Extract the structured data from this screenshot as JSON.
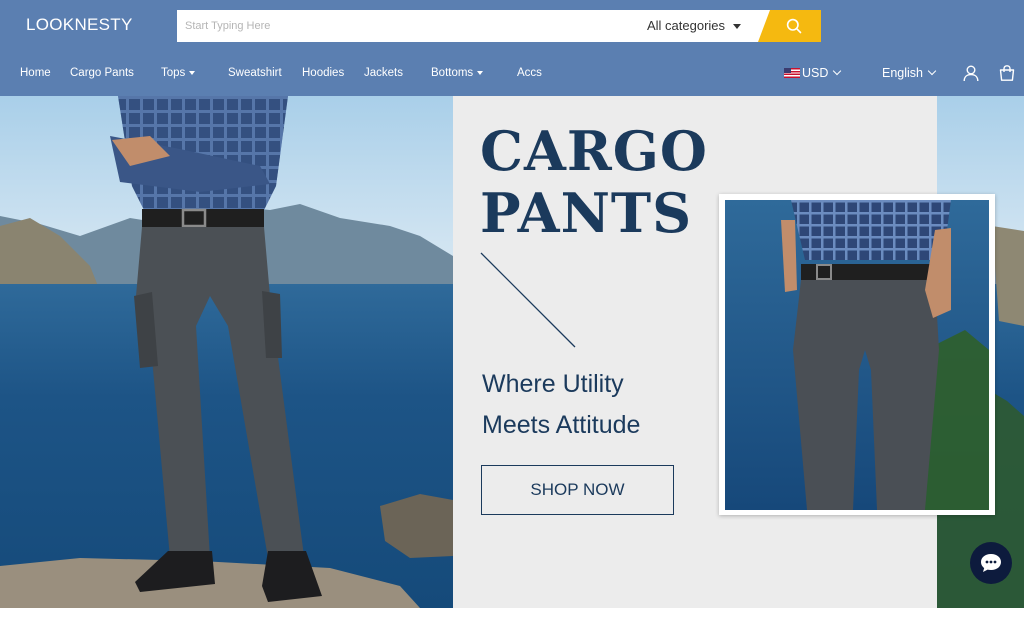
{
  "brand": {
    "name": "LOOKNESTY"
  },
  "search": {
    "placeholder": "Start Typing Here",
    "category": "All categories"
  },
  "nav": {
    "items": [
      {
        "label": "Home",
        "has_dropdown": false
      },
      {
        "label": "Cargo Pants",
        "has_dropdown": false
      },
      {
        "label": "Tops",
        "has_dropdown": true
      },
      {
        "label": "Sweatshirt",
        "has_dropdown": false
      },
      {
        "label": "Hoodies",
        "has_dropdown": false
      },
      {
        "label": "Jackets",
        "has_dropdown": false
      },
      {
        "label": "Bottoms",
        "has_dropdown": true
      },
      {
        "label": "Accs",
        "has_dropdown": false
      }
    ],
    "currency": "USD",
    "language": "English"
  },
  "hero": {
    "title_line1": "CARGO",
    "title_line2": "PANTS",
    "subtitle_line1": "Where Utility",
    "subtitle_line2": "Meets Attitude",
    "cta_label": "SHOP NOW"
  },
  "icons": {
    "search": "search-icon",
    "account": "user-icon",
    "cart": "shopping-bag-icon",
    "chat": "chat-bubble-icon",
    "flag": "us-flag-icon"
  },
  "colors": {
    "header_bg": "#5b7fb1",
    "search_button": "#f5b910",
    "hero_text": "#1b3a5c",
    "panel_bg": "#ececec",
    "chat_button": "#0d1b3d"
  }
}
